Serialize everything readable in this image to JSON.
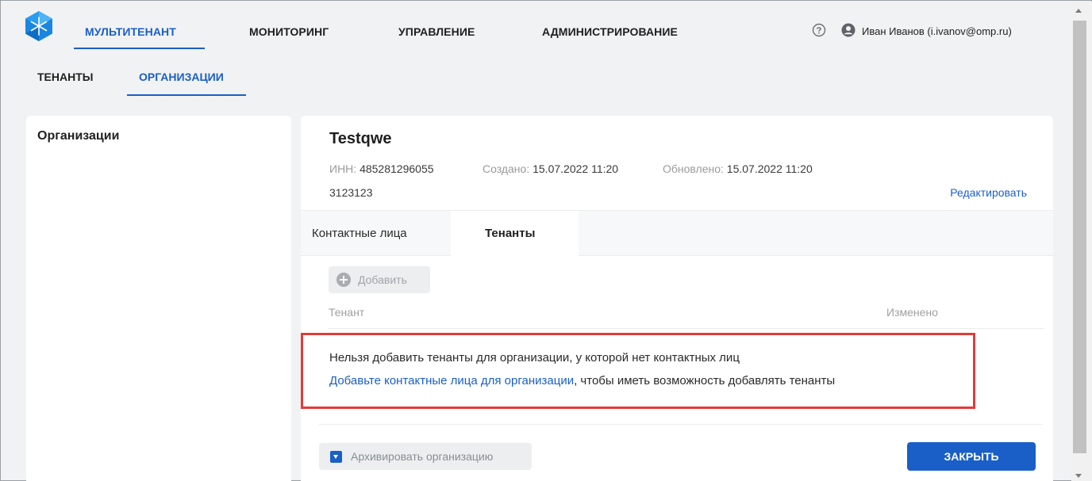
{
  "nav": {
    "items": [
      {
        "label": "МУЛЬТИТЕНАНТ",
        "active": true
      },
      {
        "label": "МОНИТОРИНГ",
        "active": false
      },
      {
        "label": "УПРАВЛЕНИЕ",
        "active": false
      },
      {
        "label": "АДМИНИСТРИРОВАНИЕ",
        "active": false
      }
    ],
    "user": "Иван Иванов (i.ivanov@omp.ru)"
  },
  "subtabs": [
    {
      "label": "ТЕНАНТЫ",
      "active": false
    },
    {
      "label": "ОРГАНИЗАЦИИ",
      "active": true
    }
  ],
  "left_panel": {
    "title": "Организации"
  },
  "organization": {
    "name": "Testqwe",
    "inn_label": "ИНН:",
    "inn_value": "485281296055",
    "created_label": "Создано:",
    "created_value": "15.07.2022 11:20",
    "updated_label": "Обновлено:",
    "updated_value": "15.07.2022 11:20",
    "extra_line": "3123123",
    "edit_label": "Редактировать"
  },
  "detail_tabs": [
    {
      "label": "Контактные лица",
      "active": false
    },
    {
      "label": "Тенанты",
      "active": true
    }
  ],
  "tenants": {
    "add_label": "Добавить",
    "col_tenant": "Тенант",
    "col_changed": "Изменено",
    "notice_text": "Нельзя добавить тенанты для организации, у которой нет контактных лиц",
    "notice_link": "Добавьте контактные лица для организации",
    "notice_rest": ", чтобы иметь возможность добавлять тенанты"
  },
  "footer": {
    "archive_label": "Архивировать организацию",
    "close_label": "ЗАКРЫТЬ"
  },
  "colors": {
    "accent": "#1a5fc8",
    "highlight_border": "#e53939",
    "background": "#f1f2f4"
  }
}
